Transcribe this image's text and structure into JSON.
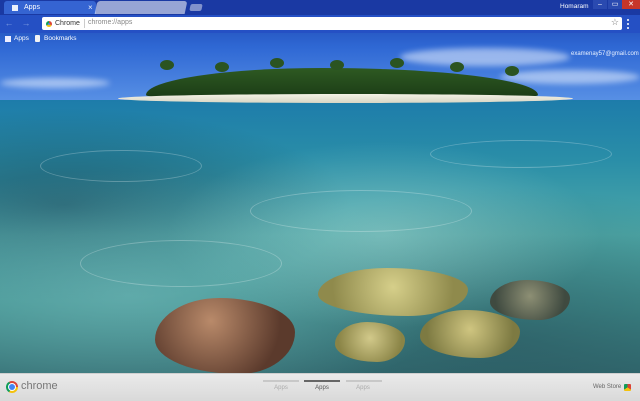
{
  "tabs": [
    {
      "label": "Apps",
      "active": true,
      "icon": "apps-grid-icon",
      "close_glyph": "×"
    },
    {
      "label": "",
      "active": false
    }
  ],
  "window": {
    "profile_name": "Homaram",
    "min_glyph": "–",
    "max_glyph": "▭",
    "close_glyph": "✕"
  },
  "toolbar": {
    "back_glyph": "←",
    "forward_glyph": "→",
    "site_chip": "Chrome",
    "url": "chrome://apps",
    "star_glyph": "☆"
  },
  "bookmarks": [
    {
      "label": "Apps",
      "icon": "apps-grid-icon"
    },
    {
      "label": "Bookmarks",
      "icon": "bookmark-page-icon"
    }
  ],
  "account_email": "examenay57@gmail.com",
  "bottom": {
    "brand": "chrome",
    "page_tabs": [
      "Apps",
      "Apps",
      "Apps"
    ],
    "active_page_index": 1,
    "webstore_label": "Web Store"
  },
  "colors": {
    "titlebar": "#1a39a3",
    "toolbar": "#2550c4",
    "close_button": "#c7362a"
  }
}
